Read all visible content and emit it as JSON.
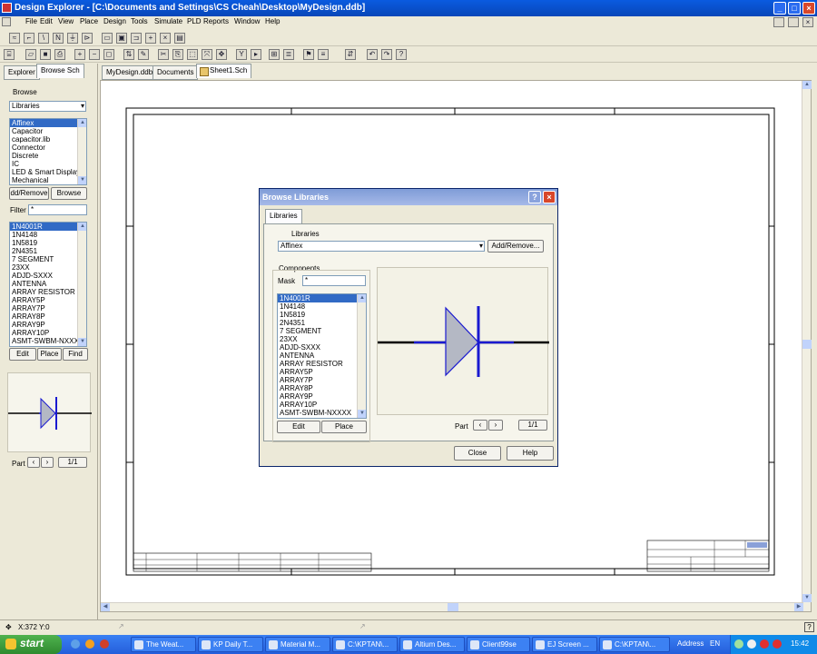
{
  "window": {
    "title": "Design Explorer - [C:\\Documents and Settings\\CS Cheah\\Desktop\\MyDesign.ddb]"
  },
  "menu": [
    "File",
    "Edit",
    "View",
    "Place",
    "Design",
    "Tools",
    "Simulate",
    "PLD",
    "Reports",
    "Window",
    "Help"
  ],
  "left_panel": {
    "tabs": [
      "Explorer",
      "Browse Sch"
    ],
    "browse_label": "Browse",
    "browse_select": "Libraries",
    "libraries": [
      "Affinex",
      "Capacitor",
      "capacitor.lib",
      "Connector",
      "Discrete",
      "IC",
      "LED & Smart Display",
      "Mechanical"
    ],
    "add_remove_label": "dd/Remove",
    "browse_button": "Browse",
    "filter_label": "Filter",
    "filter_value": "*",
    "components": [
      "1N4001R",
      "1N4148",
      "1N5819",
      "2N4351",
      "7 SEGMENT",
      "23XX",
      "ADJD-SXXX",
      "ANTENNA",
      "ARRAY RESISTOR",
      "ARRAY5P",
      "ARRAY7P",
      "ARRAY8P",
      "ARRAY9P",
      "ARRAY10P",
      "ASMT-SWBM-NXXXX"
    ],
    "edit_button": "Edit",
    "place_button": "Place",
    "find_button": "Find",
    "part_label": "Part",
    "part_value": "1/1"
  },
  "doc_tabs": [
    "MyDesign.ddb",
    "Documents",
    "Sheet1.Sch"
  ],
  "dialog": {
    "title": "Browse Libraries",
    "tab": "Libraries",
    "libraries_group": "Libraries",
    "library_value": "Affinex",
    "add_remove_button": "Add/Remove...",
    "components_group": "Components",
    "mask_label": "Mask",
    "mask_value": "*",
    "components": [
      "1N4001R",
      "1N4148",
      "1N5819",
      "2N4351",
      "7 SEGMENT",
      "23XX",
      "ADJD-SXXX",
      "ANTENNA",
      "ARRAY RESISTOR",
      "ARRAY5P",
      "ARRAY7P",
      "ARRAY8P",
      "ARRAY9P",
      "ARRAY10P",
      "ASMT-SWBM-NXXXX"
    ],
    "edit_button": "Edit",
    "place_button": "Place",
    "part_label": "Part",
    "part_value": "1/1",
    "close_button": "Close",
    "help_button": "Help"
  },
  "status": {
    "coords": "X:372 Y:0"
  },
  "taskbar": {
    "start": "start",
    "items": [
      "The Weat...",
      "KP Daily T...",
      "Material M...",
      "C:\\KPTAN\\...",
      "Altium Des...",
      "Client99se",
      "EJ Screen ...",
      "C:\\KPTAN\\..."
    ],
    "address_label": "Address",
    "lang": "EN",
    "clock": "15:42"
  },
  "colors": {
    "title_blue": "#0846b8",
    "selection": "#316ac5",
    "diode_blue": "#1a1ad0",
    "diode_fill": "#b4b8c4"
  }
}
